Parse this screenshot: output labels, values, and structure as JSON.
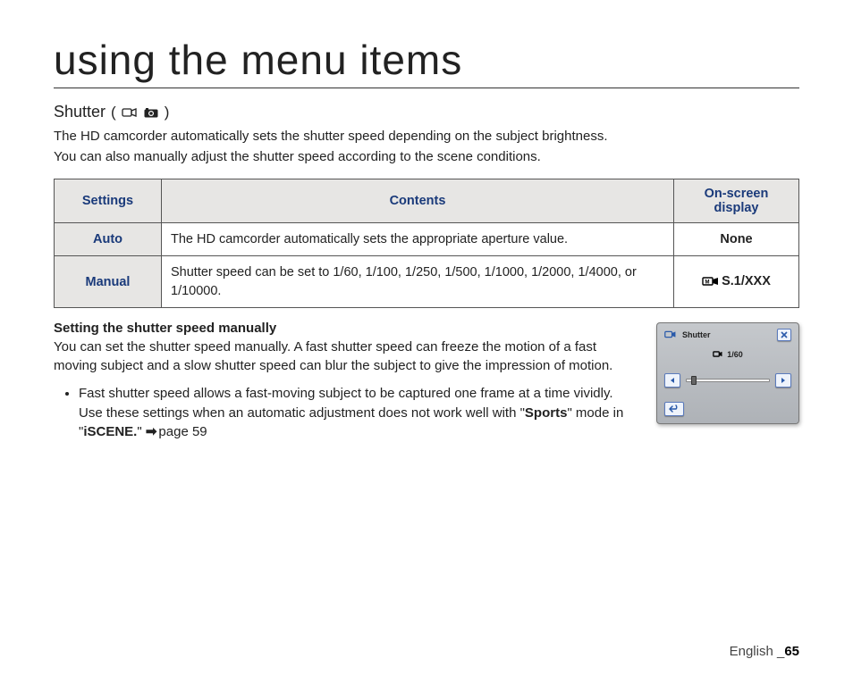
{
  "page": {
    "title": "using the menu items",
    "section_heading": "Shutter",
    "heading_icons": {
      "video": "camcorder-icon",
      "photo": "camera-icon"
    },
    "intro_line1": "The HD camcorder automatically sets the shutter speed depending on the subject brightness.",
    "intro_line2": "You can also manually adjust the shutter speed according to the scene conditions."
  },
  "table": {
    "headers": {
      "settings": "Settings",
      "contents": "Contents",
      "display": "On-screen display"
    },
    "rows": [
      {
        "label": "Auto",
        "contents": "The HD camcorder automatically sets the appropriate aperture value.",
        "display": "None",
        "display_has_icon": false
      },
      {
        "label": "Manual",
        "contents": "Shutter speed can be set to 1/60, 1/100, 1/250, 1/500, 1/1000, 1/2000, 1/4000, or 1/10000.",
        "display": "S.1/XXX",
        "display_has_icon": true
      }
    ]
  },
  "manual_section": {
    "subhead": "Setting the shutter speed manually",
    "para": "You can set the shutter speed manually. A fast shutter speed can freeze the motion of a fast moving subject and a slow shutter speed can blur the subject to give the impression of motion.",
    "bullet_pre": "Fast shutter speed allows a fast-moving subject to be captured one frame at a time vividly. Use these settings when an automatic adjustment does not work well with \"",
    "bullet_sports": "Sports",
    "bullet_mid": "\" mode in \"",
    "bullet_iscene": "iSCENE.",
    "bullet_post": "\" ",
    "bullet_pageref": "page 59"
  },
  "illustration": {
    "title": "Shutter",
    "value": "1/60"
  },
  "footer": {
    "lang": "English _",
    "page": "65"
  }
}
